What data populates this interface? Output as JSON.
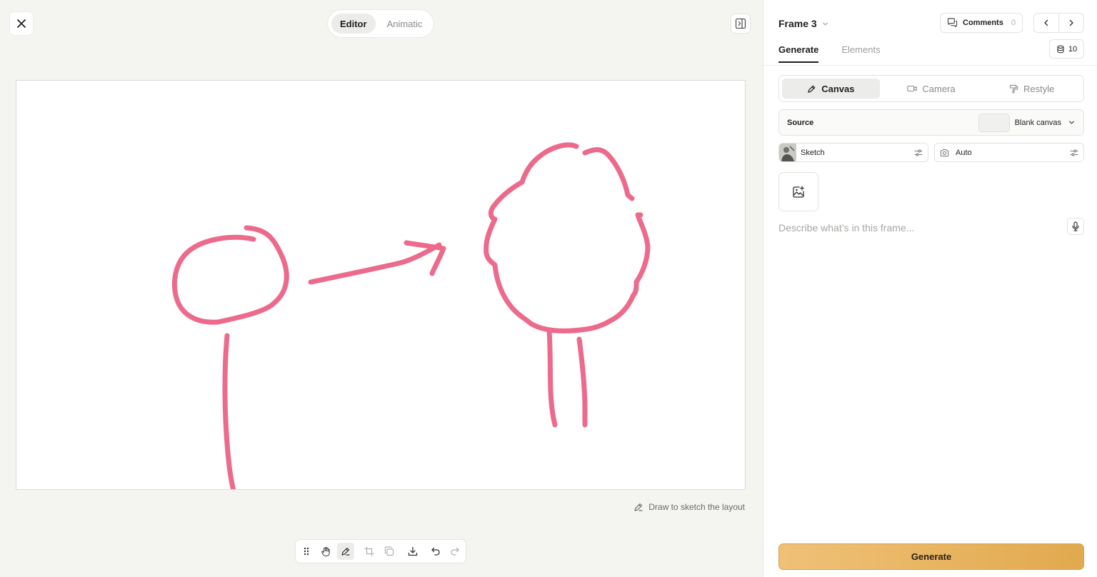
{
  "editor": {
    "close_icon": "close-icon",
    "mode_toggle": {
      "options": [
        "Editor",
        "Animatic"
      ],
      "active": "Editor"
    },
    "panel_toggle_icon": "sidebar-toggle-icon",
    "canvas": {
      "stroke_color": "#ec6a8c",
      "background": "#ffffff"
    },
    "hint": {
      "icon": "pen-icon",
      "text": "Draw to sketch the layout"
    },
    "toolbar": {
      "tools": [
        "drag-handle-icon",
        "hand-icon",
        "pen-icon",
        "crop-icon",
        "duplicate-icon",
        "download-icon",
        "undo-icon",
        "redo-icon"
      ],
      "active": "pen-icon"
    }
  },
  "panel": {
    "frame_title": "Frame 3",
    "comments": {
      "label": "Comments",
      "count": "0"
    },
    "tabs": [
      "Generate",
      "Elements"
    ],
    "active_tab": "Generate",
    "credits": "10",
    "gen_modes": [
      {
        "label": "Canvas",
        "icon": "pen-icon"
      },
      {
        "label": "Camera",
        "icon": "video-camera-icon"
      },
      {
        "label": "Restyle",
        "icon": "paint-roller-icon"
      }
    ],
    "active_gen_mode": "Canvas",
    "source": {
      "label": "Source",
      "value": "Blank canvas"
    },
    "style": {
      "label": "Sketch"
    },
    "camera": {
      "label": "Auto"
    },
    "prompt_placeholder": "Describe what’s in this frame...",
    "generate_label": "Generate"
  },
  "colors": {
    "accent": "#e6b05c",
    "stroke": "#ec6a8c",
    "text_primary": "#1f1f1f",
    "text_muted": "#8a8a86"
  }
}
